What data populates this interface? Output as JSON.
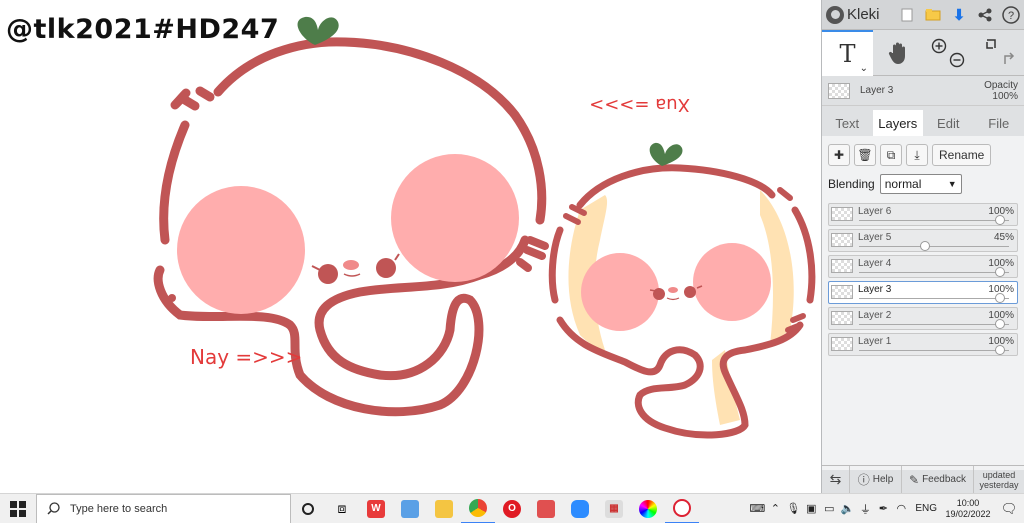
{
  "watermark": "@tlk2021#HD247",
  "canvas_labels": {
    "nay": "Nay =>>>",
    "xua": "Xua =>>>"
  },
  "app": {
    "name": "Kleki",
    "accent": "#3a8be8"
  },
  "tools": {
    "text_tool": "T",
    "hand_tool": "hand-icon",
    "zoom": "zoom-icons",
    "undo_redo": "undo-redo-icons"
  },
  "current_layer": {
    "name": "Layer 3",
    "opacity_label": "Opacity",
    "opacity_value": "100%"
  },
  "tabs": [
    {
      "label": "Text"
    },
    {
      "label": "Layers"
    },
    {
      "label": "Edit"
    },
    {
      "label": "File"
    }
  ],
  "layer_buttons": {
    "rename": "Rename"
  },
  "blending": {
    "label": "Blending",
    "value": "normal"
  },
  "layers": [
    {
      "name": "Layer 6",
      "opacity": "100%",
      "fraction": 1.0
    },
    {
      "name": "Layer 5",
      "opacity": "45%",
      "fraction": 0.45
    },
    {
      "name": "Layer 4",
      "opacity": "100%",
      "fraction": 1.0
    },
    {
      "name": "Layer 3",
      "opacity": "100%",
      "fraction": 1.0,
      "selected": true
    },
    {
      "name": "Layer 2",
      "opacity": "100%",
      "fraction": 1.0
    },
    {
      "name": "Layer 1",
      "opacity": "100%",
      "fraction": 1.0
    }
  ],
  "bottom": {
    "help": "Help",
    "feedback": "Feedback",
    "updated_line1": "updated",
    "updated_line2": "yesterday"
  },
  "taskbar": {
    "search_placeholder": "Type here to search",
    "language": "ENG",
    "time": "10:00",
    "date": "19/02/2022"
  },
  "colors": {
    "outline": "#c05555",
    "blush": "#ffadad",
    "leaf": "#4e7d4a",
    "cream": "#ffe2b3",
    "label_red": "#e33a3a"
  }
}
